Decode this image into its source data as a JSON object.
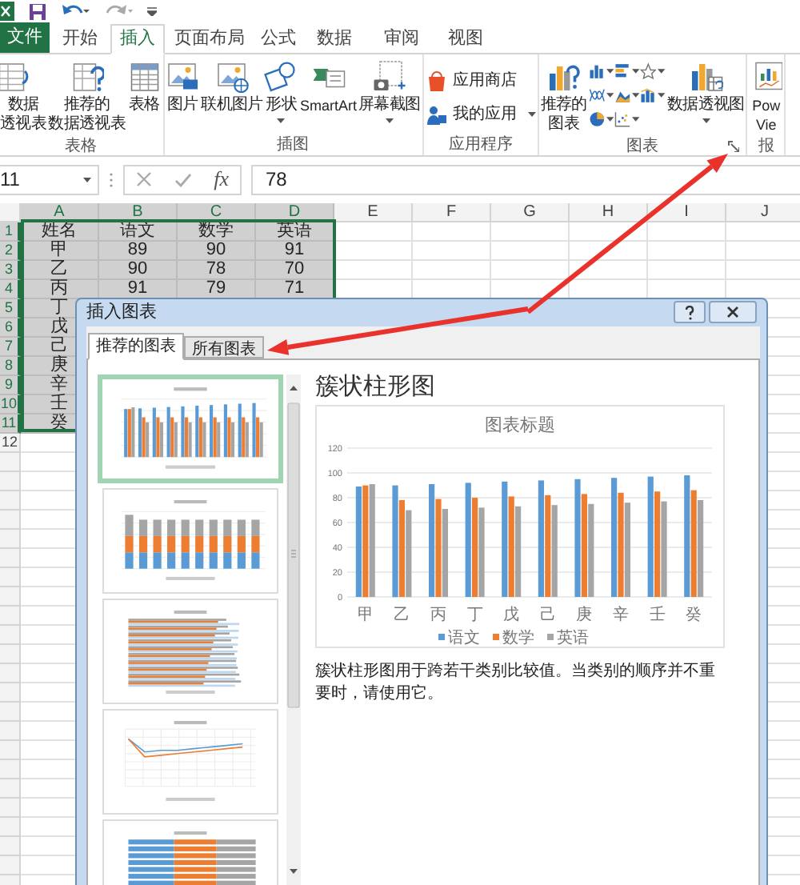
{
  "ribbon": {
    "tabs": [
      {
        "label": "文件",
        "kind": "file",
        "selected": false
      },
      {
        "label": "开始",
        "kind": "tab",
        "selected": false
      },
      {
        "label": "插入",
        "kind": "tab",
        "selected": true
      },
      {
        "label": "页面布局",
        "kind": "tab",
        "selected": false
      },
      {
        "label": "公式",
        "kind": "tab",
        "selected": false
      },
      {
        "label": "数据",
        "kind": "tab",
        "selected": false
      },
      {
        "label": "审阅",
        "kind": "tab",
        "selected": false
      },
      {
        "label": "视图",
        "kind": "tab",
        "selected": false
      }
    ],
    "groups": [
      {
        "label": "表格",
        "commands": [
          {
            "kind": "large",
            "lines": [
              "数据",
              "透视表"
            ]
          },
          {
            "kind": "large",
            "lines": [
              "推荐的",
              "数据透视表"
            ]
          },
          {
            "kind": "large",
            "lines": [
              "表格"
            ]
          }
        ]
      },
      {
        "label": "插图",
        "commands": [
          {
            "kind": "large",
            "lines": [
              "图片"
            ]
          },
          {
            "kind": "large",
            "lines": [
              "联机图片"
            ]
          },
          {
            "kind": "large",
            "lines": [
              "形状"
            ],
            "dropdown": true
          },
          {
            "kind": "large",
            "lines": [
              "SmartArt"
            ]
          },
          {
            "kind": "large",
            "lines": [
              "屏幕截图"
            ],
            "dropdown": true
          }
        ]
      },
      {
        "label": "应用程序",
        "commands": [
          {
            "kind": "small",
            "lines": [
              "应用商店"
            ]
          },
          {
            "kind": "small",
            "lines": [
              "我的应用"
            ],
            "dropdown": true
          }
        ]
      },
      {
        "label": "图表",
        "launcher": true,
        "commands": [
          {
            "kind": "large",
            "lines": [
              "推荐的",
              "图表"
            ]
          },
          {
            "kind": "gallery"
          },
          {
            "kind": "large",
            "lines": [
              "数据透视图"
            ],
            "dropdown": true
          }
        ]
      },
      {
        "label": "报",
        "commands": [
          {
            "kind": "large",
            "lines": [
              "Pow",
              "Vie"
            ]
          }
        ]
      }
    ]
  },
  "formula_bar": {
    "name_box": "11",
    "function_button": "fx",
    "value": "78"
  },
  "sheet": {
    "columns": [
      {
        "label": "A",
        "selected": true
      },
      {
        "label": "B",
        "selected": true
      },
      {
        "label": "C",
        "selected": true
      },
      {
        "label": "D",
        "selected": true
      },
      {
        "label": "E",
        "selected": false
      },
      {
        "label": "F",
        "selected": false
      },
      {
        "label": "G",
        "selected": false
      },
      {
        "label": "H",
        "selected": false
      },
      {
        "label": "I",
        "selected": false
      },
      {
        "label": "J",
        "selected": false
      }
    ],
    "rows": [
      {
        "header": "1",
        "selected": true,
        "cells": [
          "姓名",
          "语文",
          "数学",
          "英语"
        ]
      },
      {
        "header": "2",
        "selected": true,
        "cells": [
          "甲",
          "89",
          "90",
          "91"
        ]
      },
      {
        "header": "3",
        "selected": true,
        "cells": [
          "乙",
          "90",
          "78",
          "70"
        ]
      },
      {
        "header": "4",
        "selected": true,
        "cells": [
          "丙",
          "91",
          "79",
          "71"
        ]
      },
      {
        "header": "5",
        "selected": true,
        "cells": [
          "丁"
        ]
      },
      {
        "header": "6",
        "selected": true,
        "cells": [
          "戊"
        ]
      },
      {
        "header": "7",
        "selected": true,
        "cells": [
          "己"
        ]
      },
      {
        "header": "8",
        "selected": true,
        "cells": [
          "庚"
        ]
      },
      {
        "header": "9",
        "selected": true,
        "cells": [
          "辛"
        ]
      },
      {
        "header": "10",
        "selected": true,
        "cells": [
          "壬"
        ]
      },
      {
        "header": "11",
        "selected": true,
        "cells": [
          "癸"
        ]
      },
      {
        "header": "12",
        "selected": false,
        "cells": []
      }
    ]
  },
  "dialog": {
    "title": "插入图表",
    "tabs": [
      {
        "label": "推荐的图表",
        "selected": true
      },
      {
        "label": "所有图表",
        "selected": false
      }
    ],
    "thumbnails": [
      {
        "kind": "clustered_column",
        "selected": true
      },
      {
        "kind": "stacked_column",
        "selected": false
      },
      {
        "kind": "bar",
        "selected": false
      },
      {
        "kind": "line",
        "selected": false
      },
      {
        "kind": "stacked_bar",
        "selected": false
      }
    ],
    "chart_name": "簇状柱形图",
    "chart_data": {
      "type": "bar",
      "title": "图表标题",
      "categories": [
        "甲",
        "乙",
        "丙",
        "丁",
        "戊",
        "己",
        "庚",
        "辛",
        "壬",
        "癸"
      ],
      "series": [
        {
          "name": "语文",
          "color": "#5b9bd5",
          "values": [
            89,
            90,
            91,
            92,
            93,
            94,
            95,
            96,
            97,
            98
          ]
        },
        {
          "name": "数学",
          "color": "#ed7d31",
          "values": [
            90,
            78,
            79,
            80,
            81,
            82,
            83,
            84,
            85,
            86
          ]
        },
        {
          "name": "英语",
          "color": "#a5a5a5",
          "values": [
            91,
            70,
            71,
            72,
            73,
            74,
            75,
            76,
            77,
            78
          ]
        }
      ],
      "ylim": [
        0,
        120
      ],
      "yticks": [
        0,
        20,
        40,
        60,
        80,
        100,
        120
      ],
      "grid": true,
      "legend": "bottom"
    },
    "description": "簇状柱形图用于跨若干类别比较值。当类别的顺序并不重要时，请使用它。"
  }
}
